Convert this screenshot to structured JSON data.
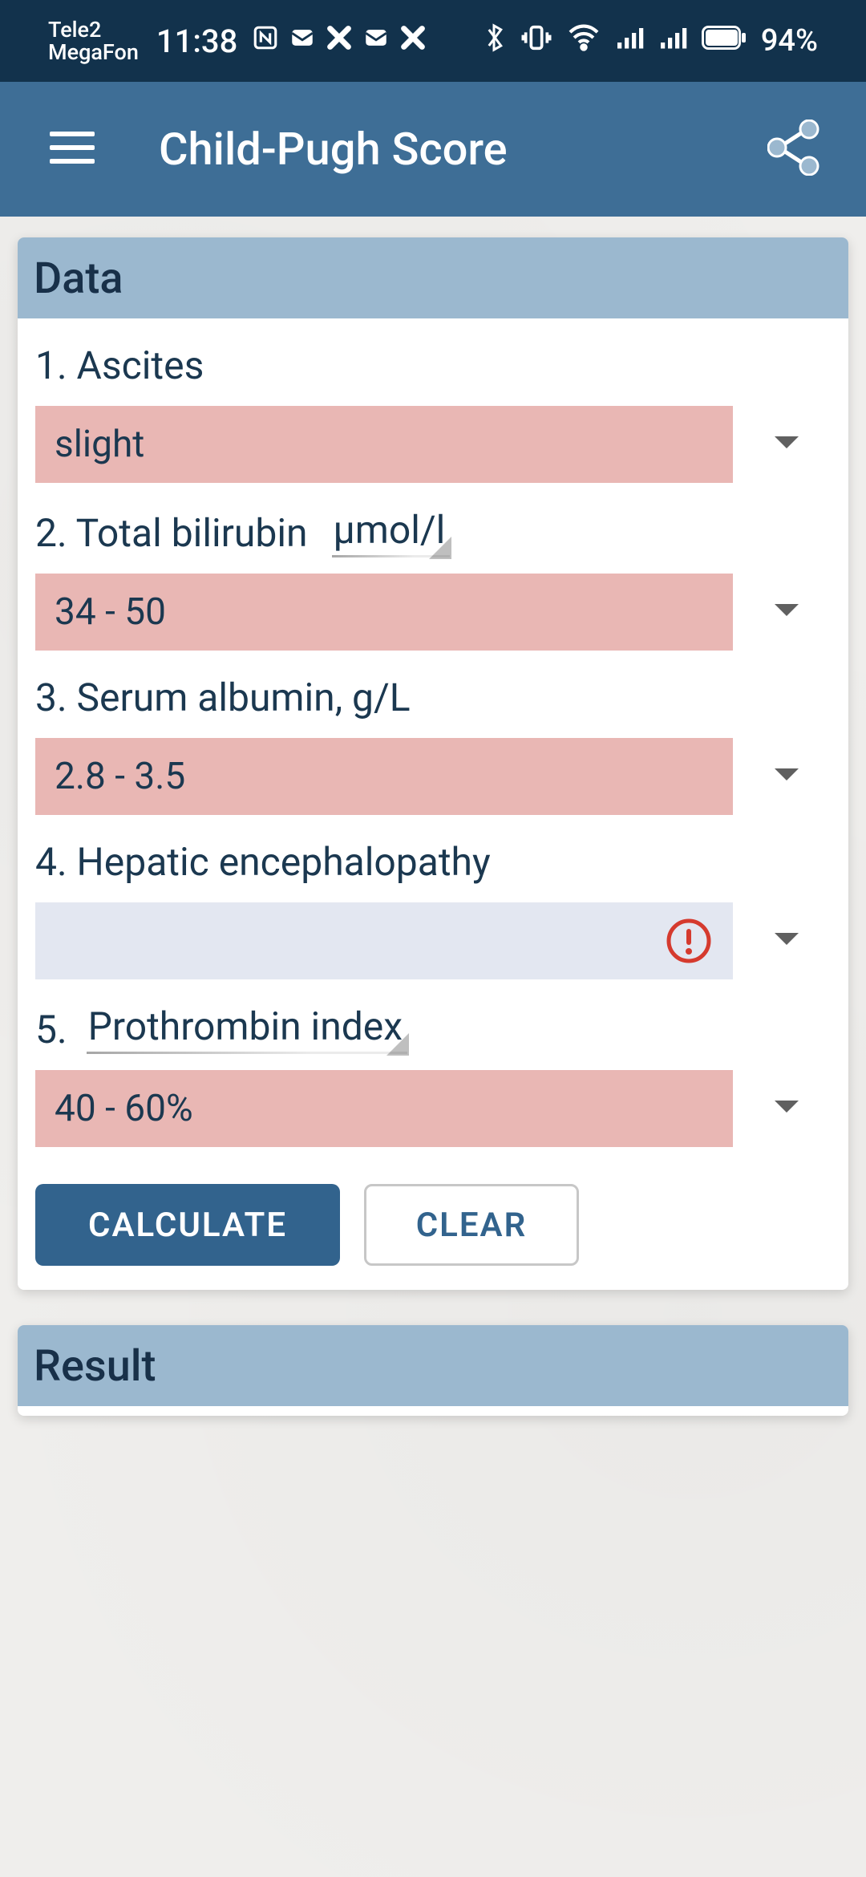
{
  "status_bar": {
    "carrier1": "Tele2",
    "carrier2": "MegaFon",
    "time": "11:38",
    "battery_text": "94%",
    "icons": {
      "notif": [
        "nfc-icon",
        "mail-icon",
        "pair-icon",
        "mail-icon",
        "pair-icon"
      ],
      "right": [
        "bluetooth-icon",
        "vibrate-icon",
        "wifi-icon",
        "signal-icon",
        "signal-icon",
        "battery-icon"
      ]
    }
  },
  "app_bar": {
    "title": "Child-Pugh Score"
  },
  "data_card": {
    "header": "Data",
    "fields": [
      {
        "label": "1. Ascites",
        "unit": "",
        "unit_editable": false,
        "value": "slight",
        "empty": false
      },
      {
        "label": "2. Total bilirubin",
        "unit": "μmol/l",
        "unit_editable": true,
        "value": "34 - 50",
        "empty": false
      },
      {
        "label": "3. Serum albumin, g/L",
        "unit": "",
        "unit_editable": false,
        "value": "2.8 - 3.5",
        "empty": false
      },
      {
        "label": "4. Hepatic encephalopathy",
        "unit": "",
        "unit_editable": false,
        "value": "",
        "empty": true
      },
      {
        "label": "5.",
        "unit": "Prothrombin index",
        "unit_editable": true,
        "value": "40 - 60%",
        "empty": false
      }
    ],
    "buttons": {
      "calculate": "CALCULATE",
      "clear": "CLEAR"
    }
  },
  "result_card": {
    "header": "Result"
  }
}
